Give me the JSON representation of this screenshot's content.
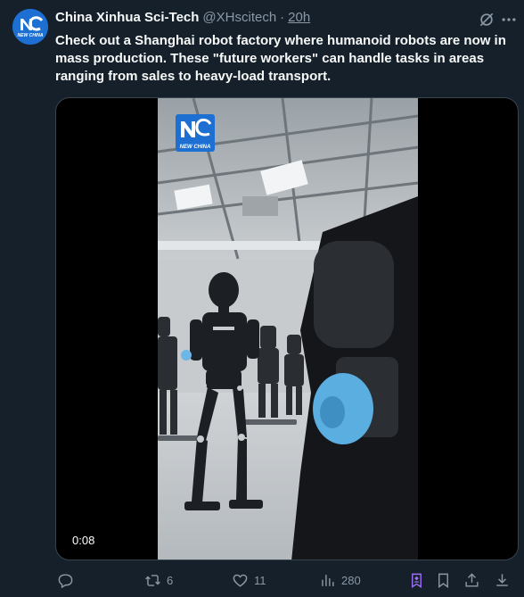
{
  "author": {
    "display_name": "China Xinhua Sci-Tech",
    "handle": "@XHscitech",
    "separator": "·",
    "time": "20h",
    "avatar_text": "NEW CHINA"
  },
  "tweet": {
    "text": "Check out a Shanghai robot factory where humanoid robots are now in mass production. These \"future workers\" can handle tasks in areas ranging from sales to heavy-load transport."
  },
  "media": {
    "video_time": "0:08",
    "watermark_text": "NEW CHINA"
  },
  "actions": {
    "reply_count": "",
    "repost_count": "6",
    "like_count": "11",
    "views_count": "280"
  },
  "colors": {
    "background": "#15202b",
    "text": "#f7f9f9",
    "muted": "#8b98a5",
    "premium": "#9b6ef3",
    "brand_blue": "#1d6fd1"
  },
  "icons": [
    "grok-icon",
    "more-icon",
    "reply-icon",
    "repost-icon",
    "like-icon",
    "views-icon",
    "grok-badge-icon",
    "bookmark-icon",
    "share-icon",
    "download-icon"
  ]
}
